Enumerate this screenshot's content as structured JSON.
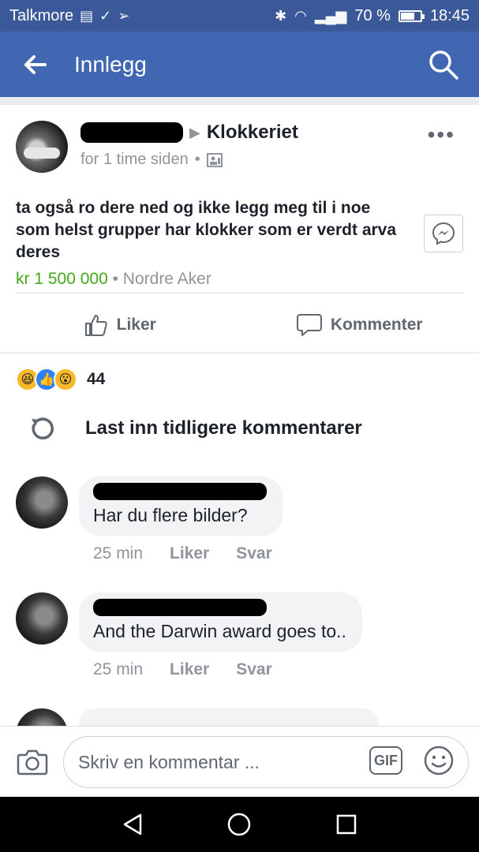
{
  "status_bar": {
    "carrier": "Talkmore",
    "battery": "70 %",
    "battery_level": 0.7,
    "time": "18:45"
  },
  "app_bar": {
    "title": "Innlegg",
    "back_icon": "arrow-left-icon",
    "search_icon": "search-icon"
  },
  "post": {
    "group": "Klokkeriet",
    "time": "for 1 time siden",
    "text": "ta også ro dere ned og ikke legg meg til i noe som helst grupper har klokker som er verdt arva deres",
    "price": "kr 1 500 000",
    "location": "Nordre Aker",
    "actions": {
      "like": "Liker",
      "comment": "Kommenter"
    }
  },
  "reactions": {
    "count": "44",
    "types": [
      "haha",
      "like",
      "wow"
    ]
  },
  "load_more": "Last inn tidligere kommentarer",
  "comments": [
    {
      "text": "Har du flere bilder?",
      "time": "25 min",
      "like": "Liker",
      "reply": "Svar"
    },
    {
      "text": "And the Darwin award goes to..",
      "time": "25 min",
      "like": "Liker",
      "reply": "Svar"
    }
  ],
  "composer": {
    "placeholder": "Skriv en kommentar ...",
    "gif": "GIF"
  },
  "colors": {
    "status_bar": "#3b5998",
    "app_bar": "#4267b2",
    "price": "#42a81c"
  }
}
